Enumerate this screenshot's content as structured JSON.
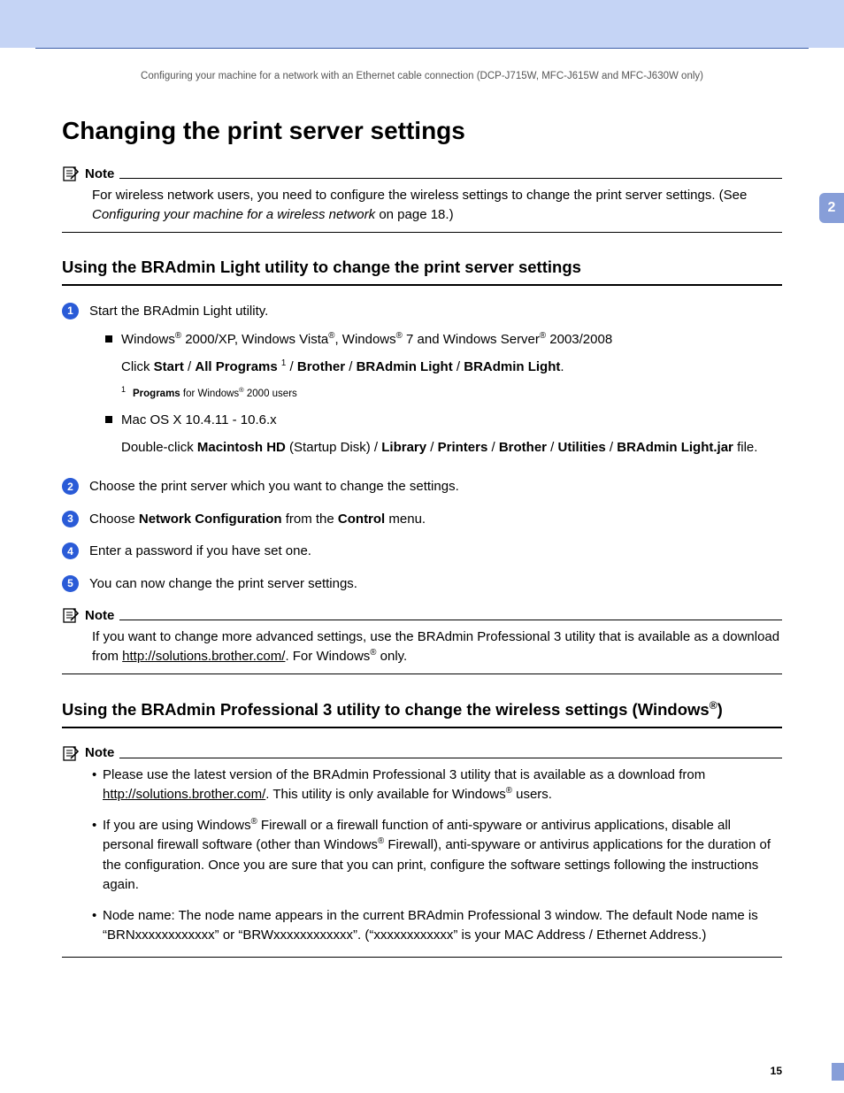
{
  "runningHead": "Configuring your machine for a network with an Ethernet cable connection (DCP-J715W, MFC-J615W and MFC-J630W only)",
  "title": "Changing the print server settings",
  "chapterTab": "2",
  "pageNumber": "15",
  "note1": {
    "label": "Note",
    "text_a": "For wireless network users, you need to configure the wireless settings to change the print server settings. (See ",
    "text_em": "Configuring your machine for a wireless network",
    "text_b": " on page 18.)"
  },
  "section1": {
    "heading": "Using the BRAdmin Light utility to change the print server settings",
    "steps": {
      "s1": {
        "text": "Start the BRAdmin Light utility.",
        "bullet1_a": "Windows",
        "bullet1_b": " 2000/XP, Windows Vista",
        "bullet1_c": ", Windows",
        "bullet1_d": " 7 and Windows Server",
        "bullet1_e": " 2003/2008",
        "path1_pre": "Click ",
        "path1_b1": "Start",
        "path1_b2": "All Programs",
        "path1_b3": "Brother",
        "path1_b4": "BRAdmin Light",
        "path1_b5": "BRAdmin Light",
        "fn_num": "1",
        "fn_b": "Programs",
        "fn_a": " for Windows",
        "fn_c": " 2000 users",
        "bullet2": "Mac OS X 10.4.11 - 10.6.x",
        "path2_pre": "Double-click ",
        "path2_b1": "Macintosh HD",
        "path2_mid": " (Startup Disk) / ",
        "path2_b2": "Library",
        "path2_b3": "Printers",
        "path2_b4": "Brother",
        "path2_b5": "Utilities",
        "path2_b6": "BRAdmin Light.jar",
        "path2_end": " file."
      },
      "s2": "Choose the print server which you want to change the settings.",
      "s3_a": "Choose ",
      "s3_b1": "Network Configuration",
      "s3_b": " from the ",
      "s3_b2": "Control",
      "s3_c": " menu.",
      "s4": "Enter a password if you have set one.",
      "s5": "You can now change the print server settings."
    }
  },
  "note2": {
    "label": "Note",
    "text_a": "If you want to change more advanced settings, use the BRAdmin Professional 3 utility that is available as a download from ",
    "link": "http://solutions.brother.com/",
    "text_b": ". For Windows",
    "text_c": " only."
  },
  "section2": {
    "heading_a": "Using the BRAdmin Professional 3 utility to change the wireless settings (Windows",
    "heading_b": ")"
  },
  "note3": {
    "label": "Note",
    "b1_a": "Please use the latest version of the BRAdmin Professional 3 utility that is available as a download from ",
    "b1_link": "http://solutions.brother.com/",
    "b1_b": ". This utility is only available for Windows",
    "b1_c": " users.",
    "b2_a": "If you are using Windows",
    "b2_b": " Firewall or a firewall function of anti-spyware or antivirus applications, disable all personal firewall software (other than Windows",
    "b2_c": " Firewall), anti-spyware or antivirus applications for the duration of the configuration. Once you are sure that you can print, configure the software settings following the instructions again.",
    "b3": "Node name: The node name appears in the current BRAdmin Professional 3 window. The default Node name is “BRNxxxxxxxxxxxx” or “BRWxxxxxxxxxxxx”. (“xxxxxxxxxxxx” is your MAC Address / Ethernet Address.)"
  }
}
